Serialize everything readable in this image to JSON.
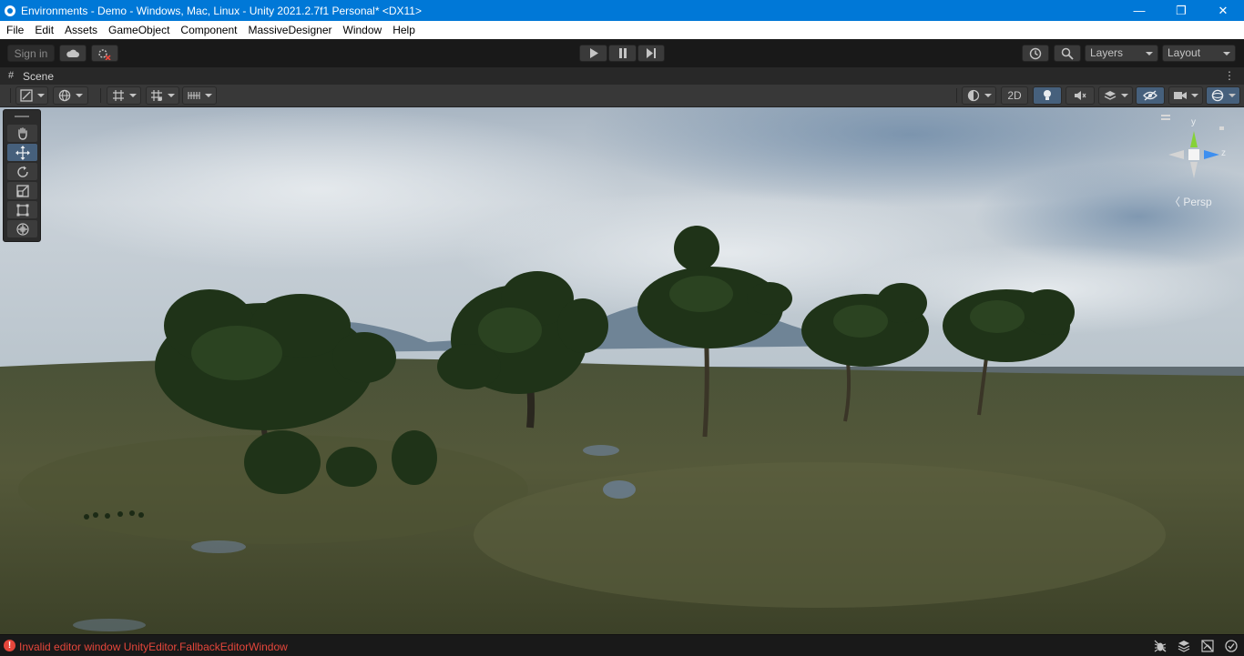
{
  "window": {
    "title": "Environments - Demo - Windows, Mac, Linux - Unity 2021.2.7f1 Personal* <DX11>",
    "minimize": "—",
    "restore": "❐",
    "close": "✕"
  },
  "menu": [
    "File",
    "Edit",
    "Assets",
    "GameObject",
    "Component",
    "MassiveDesigner",
    "Window",
    "Help"
  ],
  "toolbar": {
    "signin_label": "Sign in",
    "layers_label": "Layers",
    "layout_label": "Layout"
  },
  "scene_tab": {
    "icon": "#",
    "label": "Scene",
    "menu": "⋮"
  },
  "scene_toolbar": {
    "mode_2d_label": "2D"
  },
  "tools": {
    "active": "move-tool",
    "items": [
      "hand-tool",
      "move-tool",
      "rotate-tool",
      "scale-tool",
      "rect-tool",
      "transform-tool"
    ]
  },
  "gizmo": {
    "y_label": "y",
    "z_label": "z",
    "projection_label": "〈 Persp"
  },
  "status": {
    "error_icon": "!",
    "message": "Invalid editor window UnityEditor.FallbackEditorWindow"
  },
  "colors": {
    "titlebar": "#0078d7",
    "accent": "#46607c",
    "error": "#e5463b"
  }
}
